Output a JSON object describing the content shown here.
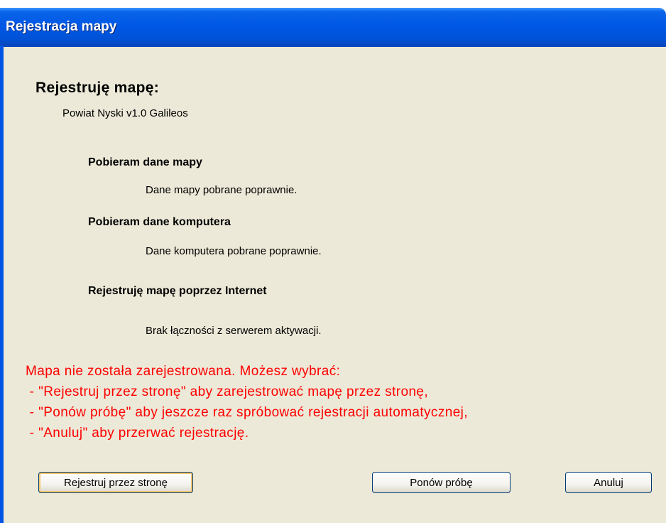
{
  "window": {
    "title": "Rejestracja mapy"
  },
  "heading": "Rejestruję mapę:",
  "map_name": "Powiat Nyski v1.0 Galileos",
  "steps": [
    {
      "title": "Pobieram dane mapy",
      "detail": "Dane mapy pobrane poprawnie."
    },
    {
      "title": "Pobieram dane komputera",
      "detail": "Dane komputera pobrane poprawnie."
    },
    {
      "title": "Rejestruję mapę poprzez Internet",
      "detail": "Brak łączności z serwerem aktywacji."
    }
  ],
  "error": {
    "color": "#ff0000",
    "lines": [
      "Mapa nie została zarejestrowana. Możesz wybrać:",
      " - \"Rejestruj przez stronę\" aby zarejestrować mapę przez stronę,",
      " - \"Ponów próbę\" aby jeszcze raz spróbować rejestracji automatycznej,",
      " - \"Anuluj\" aby przerwać rejestrację."
    ]
  },
  "buttons": {
    "register_web": "Rejestruj przez stronę",
    "retry": "Ponów próbę",
    "cancel": "Anuluj"
  },
  "colors": {
    "titlebar": "#0058e6",
    "dialog_bg": "#ece9d8"
  }
}
